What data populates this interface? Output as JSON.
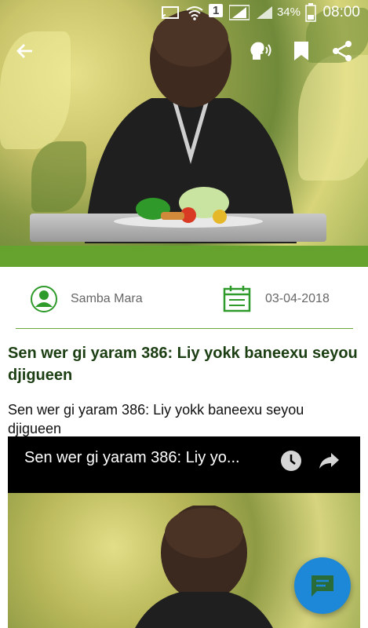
{
  "status": {
    "battery_pct": "34%",
    "time": "08:00",
    "sim_number": "1"
  },
  "article": {
    "author": "Samba Mara",
    "date": "03-04-2018",
    "title": "Sen wer gi yaram 386: Liy yokk baneexu seyou djigueen",
    "body": "Sen wer gi yaram 386: Liy yokk baneexu seyou djigueen"
  },
  "video": {
    "title": "Sen wer gi yaram 386: Liy yo..."
  },
  "colors": {
    "accent_green": "#66a32e",
    "title_green": "#1b3e12",
    "fab_blue": "#1e88d8"
  },
  "icons": {
    "back": "back-arrow-icon",
    "speak": "speak-icon",
    "bookmark": "bookmark-icon",
    "share": "share-icon",
    "author": "user-icon",
    "date": "calendar-icon",
    "watch_later": "clock-icon",
    "video_share": "share-arrow-icon",
    "fab": "chat-icon"
  }
}
